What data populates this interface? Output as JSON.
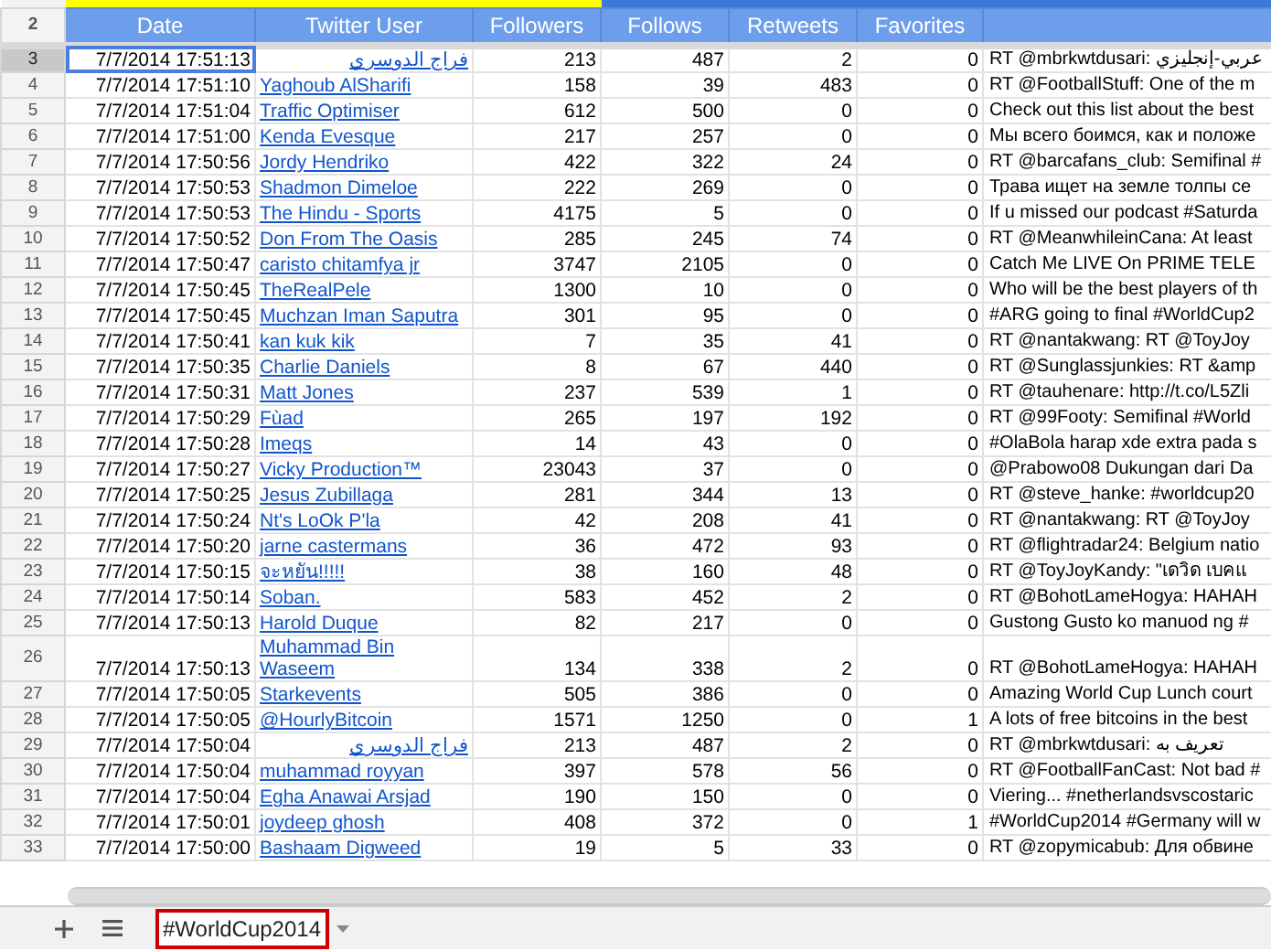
{
  "columns": [
    {
      "row_number": "2",
      "label": "Date"
    },
    {
      "label": "Twitter User"
    },
    {
      "label": "Followers"
    },
    {
      "label": "Follows"
    },
    {
      "label": "Retweets"
    },
    {
      "label": "Favorites"
    }
  ],
  "rows": [
    {
      "number": "3",
      "date": "7/7/2014 17:51:13",
      "user": "فراج الدوسري",
      "followers": "213",
      "follows": "487",
      "retweets": "2",
      "favorites": "0",
      "tweet": "RT @mbrkwtdusari: عربي-إنجليزي",
      "selected": true
    },
    {
      "number": "4",
      "date": "7/7/2014 17:51:10",
      "user": "Yaghoub AlSharifi",
      "followers": "158",
      "follows": "39",
      "retweets": "483",
      "favorites": "0",
      "tweet": "RT @FootballStuff: One of the m",
      "selected": false
    },
    {
      "number": "5",
      "date": "7/7/2014 17:51:04",
      "user": "Traffic Optimiser",
      "followers": "612",
      "follows": "500",
      "retweets": "0",
      "favorites": "0",
      "tweet": "Check out this list about the best",
      "selected": false
    },
    {
      "number": "6",
      "date": "7/7/2014 17:51:00",
      "user": "Kenda Evesque",
      "followers": "217",
      "follows": "257",
      "retweets": "0",
      "favorites": "0",
      "tweet": "Мы всего боимся, как и положе",
      "selected": false
    },
    {
      "number": "7",
      "date": "7/7/2014 17:50:56",
      "user": "Jordy Hendriko",
      "followers": "422",
      "follows": "322",
      "retweets": "24",
      "favorites": "0",
      "tweet": "RT @barcafans_club: Semifinal #",
      "selected": false
    },
    {
      "number": "8",
      "date": "7/7/2014 17:50:53",
      "user": "Shadmon Dimeloe",
      "followers": "222",
      "follows": "269",
      "retweets": "0",
      "favorites": "0",
      "tweet": "Трава ищет на земле толпы се",
      "selected": false
    },
    {
      "number": "9",
      "date": "7/7/2014 17:50:53",
      "user": "The Hindu - Sports",
      "followers": "4175",
      "follows": "5",
      "retweets": "0",
      "favorites": "0",
      "tweet": "If u missed our podcast #Saturda",
      "selected": false
    },
    {
      "number": "10",
      "date": "7/7/2014 17:50:52",
      "user": "Don From The Oasis",
      "followers": "285",
      "follows": "245",
      "retweets": "74",
      "favorites": "0",
      "tweet": "RT @MeanwhileinCana: At least",
      "selected": false
    },
    {
      "number": "11",
      "date": "7/7/2014 17:50:47",
      "user": "caristo chitamfya jr",
      "followers": "3747",
      "follows": "2105",
      "retweets": "0",
      "favorites": "0",
      "tweet": "Catch Me LIVE On PRIME TELE",
      "selected": false
    },
    {
      "number": "12",
      "date": "7/7/2014 17:50:45",
      "user": "TheRealPele",
      "followers": "1300",
      "follows": "10",
      "retweets": "0",
      "favorites": "0",
      "tweet": "Who will be the best players of th",
      "selected": false
    },
    {
      "number": "13",
      "date": "7/7/2014 17:50:45",
      "user": "Muchzan Iman Saputra",
      "followers": "301",
      "follows": "95",
      "retweets": "0",
      "favorites": "0",
      "tweet": "#ARG going to final #WorldCup2",
      "selected": false
    },
    {
      "number": "14",
      "date": "7/7/2014 17:50:41",
      "user": "kan kuk kik",
      "followers": "7",
      "follows": "35",
      "retweets": "41",
      "favorites": "0",
      "tweet": "RT @nantakwang: RT @ToyJoy",
      "selected": false
    },
    {
      "number": "15",
      "date": "7/7/2014 17:50:35",
      "user": "Charlie Daniels",
      "followers": "8",
      "follows": "67",
      "retweets": "440",
      "favorites": "0",
      "tweet": "RT @Sunglassjunkies: RT &amp",
      "selected": false
    },
    {
      "number": "16",
      "date": "7/7/2014 17:50:31",
      "user": "Matt Jones",
      "followers": "237",
      "follows": "539",
      "retweets": "1",
      "favorites": "0",
      "tweet": "RT @tauhenare: http://t.co/L5Zli",
      "selected": false
    },
    {
      "number": "17",
      "date": "7/7/2014 17:50:29",
      "user": "Fùad",
      "followers": "265",
      "follows": "197",
      "retweets": "192",
      "favorites": "0",
      "tweet": "RT @99Footy: Semifinal #World",
      "selected": false
    },
    {
      "number": "18",
      "date": "7/7/2014 17:50:28",
      "user": "Imeqs",
      "followers": "14",
      "follows": "43",
      "retweets": "0",
      "favorites": "0",
      "tweet": "#OlaBola harap xde extra pada s",
      "selected": false
    },
    {
      "number": "19",
      "date": "7/7/2014 17:50:27",
      "user": "Vicky Production™",
      "followers": "23043",
      "follows": "37",
      "retweets": "0",
      "favorites": "0",
      "tweet": "@Prabowo08 Dukungan dari Da",
      "selected": false
    },
    {
      "number": "20",
      "date": "7/7/2014 17:50:25",
      "user": "Jesus Zubillaga",
      "followers": "281",
      "follows": "344",
      "retweets": "13",
      "favorites": "0",
      "tweet": "RT @steve_hanke: #worldcup20",
      "selected": false
    },
    {
      "number": "21",
      "date": "7/7/2014 17:50:24",
      "user": "Nt's LoOk P'la",
      "followers": "42",
      "follows": "208",
      "retweets": "41",
      "favorites": "0",
      "tweet": "RT @nantakwang: RT @ToyJoy",
      "selected": false
    },
    {
      "number": "22",
      "date": "7/7/2014 17:50:20",
      "user": "jarne castermans",
      "followers": "36",
      "follows": "472",
      "retweets": "93",
      "favorites": "0",
      "tweet": "RT @flightradar24: Belgium natio",
      "selected": false
    },
    {
      "number": "23",
      "date": "7/7/2014 17:50:15",
      "user": "จะหยัน!!!!!",
      "followers": "38",
      "follows": "160",
      "retweets": "48",
      "favorites": "0",
      "tweet": "RT @ToyJoyKandy: \"เดวิด เบคแ",
      "selected": false
    },
    {
      "number": "24",
      "date": "7/7/2014 17:50:14",
      "user": "Soban.",
      "followers": "583",
      "follows": "452",
      "retweets": "2",
      "favorites": "0",
      "tweet": "RT @BohotLameHogya: HAHAH",
      "selected": false
    },
    {
      "number": "25",
      "date": "7/7/2014 17:50:13",
      "user": "Harold Duque",
      "followers": "82",
      "follows": "217",
      "retweets": "0",
      "favorites": "0",
      "tweet": "Gustong Gusto ko manuod ng #",
      "selected": false
    },
    {
      "number": "26",
      "date": "7/7/2014 17:50:13",
      "user": "Muhammad Bin Waseem",
      "followers": "134",
      "follows": "338",
      "retweets": "2",
      "favorites": "0",
      "tweet": "RT @BohotLameHogya: HAHAH",
      "selected": false
    },
    {
      "number": "27",
      "date": "7/7/2014 17:50:05",
      "user": "Starkevents",
      "followers": "505",
      "follows": "386",
      "retweets": "0",
      "favorites": "0",
      "tweet": "Amazing World Cup Lunch court",
      "selected": false
    },
    {
      "number": "28",
      "date": "7/7/2014 17:50:05",
      "user": "@HourlyBitcoin",
      "followers": "1571",
      "follows": "1250",
      "retweets": "0",
      "favorites": "1",
      "tweet": "A lots of free bitcoins in the best",
      "selected": false
    },
    {
      "number": "29",
      "date": "7/7/2014 17:50:04",
      "user": "فراج الدوسري",
      "followers": "213",
      "follows": "487",
      "retweets": "2",
      "favorites": "0",
      "tweet": "RT @mbrkwtdusari: تعريف به",
      "selected": false
    },
    {
      "number": "30",
      "date": "7/7/2014 17:50:04",
      "user": "muhammad royyan",
      "followers": "397",
      "follows": "578",
      "retweets": "56",
      "favorites": "0",
      "tweet": "RT @FootballFanCast: Not bad #",
      "selected": false
    },
    {
      "number": "31",
      "date": "7/7/2014 17:50:04",
      "user": "Egha Anawai Arsjad",
      "followers": "190",
      "follows": "150",
      "retweets": "0",
      "favorites": "0",
      "tweet": "Viering... #netherlandsvscostaric",
      "selected": false
    },
    {
      "number": "32",
      "date": "7/7/2014 17:50:01",
      "user": "joydeep ghosh",
      "followers": "408",
      "follows": "372",
      "retweets": "0",
      "favorites": "1",
      "tweet": "#WorldCup2014 #Germany will w",
      "selected": false
    },
    {
      "number": "33",
      "date": "7/7/2014 17:50:00",
      "user": "Bashaam Digweed",
      "followers": "19",
      "follows": "5",
      "retweets": "33",
      "favorites": "0",
      "tweet": "RT @zopymicabub: Для обвине",
      "selected": false
    }
  ],
  "sheet_tabs": [
    {
      "label": "#WorldCup2014",
      "selected": true
    }
  ]
}
